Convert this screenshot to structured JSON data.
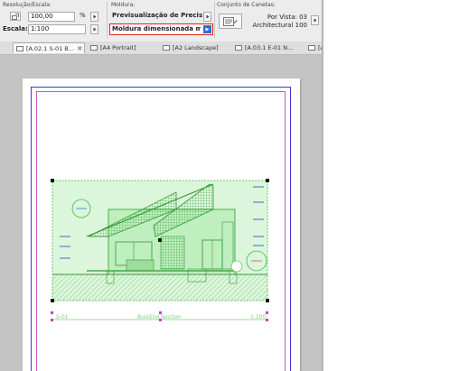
{
  "infobox": {
    "resolution_label": "Resolução/Escala:",
    "resolution_value": "100,00",
    "percent_symbol": "%",
    "scale_label": "Escala:",
    "scale_value": "1:100",
    "frame_label": "Moldura:",
    "frame_preview": "Previsualização de Precisão T...",
    "frame_type": "Moldura dimensionada man...",
    "penset_label": "Conjunto de Canetas:",
    "penset_line1": "Por Vista: 03",
    "penset_line2": "Architectural 100",
    "highlight_color": "#e0241b",
    "accent_color": "#2b6fd6"
  },
  "tabs": [
    {
      "label": "[A.02.1 S-01 B...",
      "active": true,
      "closable": true
    },
    {
      "label": "[A4 Portrait]",
      "active": false
    },
    {
      "label": "[A2 Landscape]",
      "active": false
    },
    {
      "label": "[A.03.1 E-01 N...",
      "active": false
    },
    {
      "label": "[A",
      "active": false
    }
  ],
  "drawing": {
    "title_left": "S-01",
    "title_mid": "Building Section",
    "title_right": "1:100",
    "drawing_color": "#3fb83f",
    "fill_color": "#cdf3cd"
  }
}
